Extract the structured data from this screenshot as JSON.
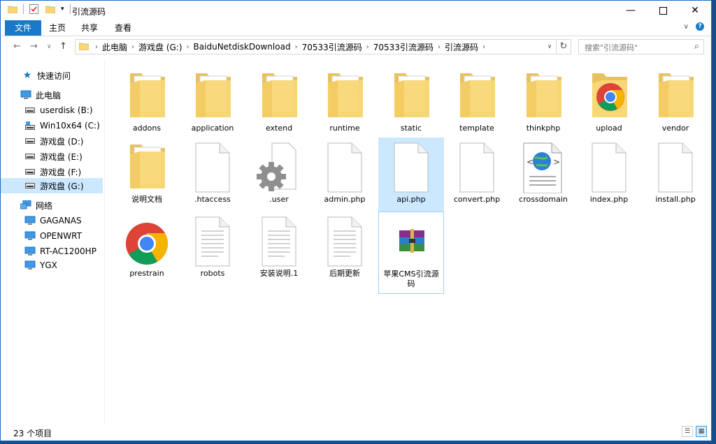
{
  "window": {
    "title": "引流源码",
    "minimize_icon": "minimize-icon",
    "maximize_icon": "maximize-icon",
    "close_icon": "close-icon"
  },
  "ribbon": {
    "tabs": [
      "文件",
      "主页",
      "共享",
      "查看"
    ]
  },
  "address": {
    "crumbs": [
      "此电脑",
      "游戏盘 (G:)",
      "BaiduNetdiskDownload",
      "70533引流源码",
      "70533引流源码",
      "引流源码"
    ]
  },
  "search": {
    "placeholder": "搜索\"引流源码\""
  },
  "nav": {
    "items": [
      {
        "label": "快速访问",
        "icon": "star-icon"
      },
      {
        "label": "此电脑",
        "icon": "computer-icon"
      },
      {
        "label": "userdisk (B:)",
        "icon": "drive-icon"
      },
      {
        "label": "Win10x64 (C:)",
        "icon": "system-drive-icon"
      },
      {
        "label": "游戏盘 (D:)",
        "icon": "drive-icon"
      },
      {
        "label": "游戏盘 (E:)",
        "icon": "drive-icon"
      },
      {
        "label": "游戏盘 (F:)",
        "icon": "drive-icon"
      },
      {
        "label": "游戏盘 (G:)",
        "icon": "drive-icon"
      },
      {
        "label": "网络",
        "icon": "network-icon"
      },
      {
        "label": "GAGANAS",
        "icon": "network-computer-icon"
      },
      {
        "label": "OPENWRT",
        "icon": "network-computer-icon"
      },
      {
        "label": "RT-AC1200HP",
        "icon": "network-computer-icon"
      },
      {
        "label": "YGX",
        "icon": "network-computer-icon"
      }
    ]
  },
  "files": [
    {
      "name": "addons",
      "icon": "folder-icon"
    },
    {
      "name": "application",
      "icon": "folder-icon"
    },
    {
      "name": "extend",
      "icon": "folder-icon"
    },
    {
      "name": "runtime",
      "icon": "folder-icon"
    },
    {
      "name": "static",
      "icon": "folder-icon"
    },
    {
      "name": "template",
      "icon": "folder-icon"
    },
    {
      "name": "thinkphp",
      "icon": "folder-icon"
    },
    {
      "name": "upload",
      "icon": "chrome-folder-icon"
    },
    {
      "name": "vendor",
      "icon": "folder-icon"
    },
    {
      "name": "说明文档",
      "icon": "folder-icon"
    },
    {
      "name": ".htaccess",
      "icon": "blank-file-icon"
    },
    {
      "name": ".user",
      "icon": "settings-file-icon"
    },
    {
      "name": "admin.php",
      "icon": "blank-file-icon"
    },
    {
      "name": "api.php",
      "icon": "blank-file-icon"
    },
    {
      "name": "convert.php",
      "icon": "blank-file-icon"
    },
    {
      "name": "crossdomain",
      "icon": "xml-file-icon"
    },
    {
      "name": "index.php",
      "icon": "blank-file-icon"
    },
    {
      "name": "install.php",
      "icon": "blank-file-icon"
    },
    {
      "name": "prestrain",
      "icon": "chrome-icon"
    },
    {
      "name": "robots",
      "icon": "text-file-icon"
    },
    {
      "name": "安装说明.1",
      "icon": "text-file-icon"
    },
    {
      "name": "后期更新",
      "icon": "text-file-icon"
    },
    {
      "name": "苹果CMS引流源码",
      "icon": "winrar-archive-icon"
    }
  ],
  "status": {
    "count": "23 个项目"
  },
  "colors": {
    "accent": "#1979ca",
    "selection": "#cce8ff",
    "folder": "#f8d775"
  }
}
